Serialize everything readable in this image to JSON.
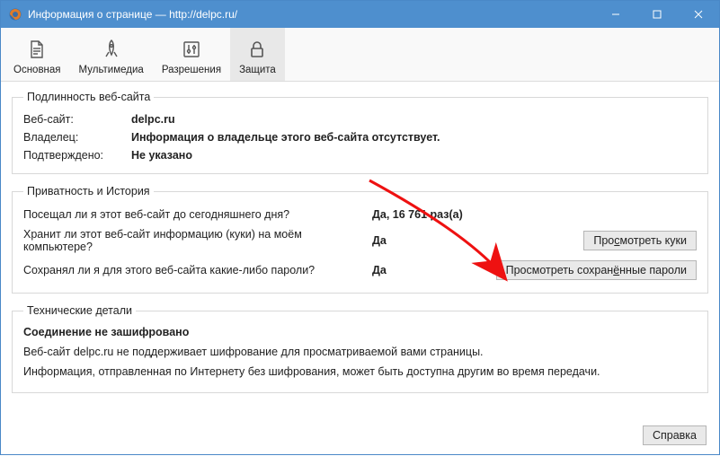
{
  "titlebar": {
    "text": "Информация о странице — http://delpc.ru/"
  },
  "tabs": {
    "general": {
      "label": "Основная"
    },
    "media": {
      "label": "Мультимедиа"
    },
    "permissions": {
      "label": "Разрешения"
    },
    "security": {
      "label": "Защита"
    }
  },
  "identity": {
    "legend": "Подлинность веб-сайта",
    "website_label": "Веб-сайт:",
    "website_value": "delpc.ru",
    "owner_label": "Владелец:",
    "owner_value": "Информация о владельце этого веб-сайта отсутствует.",
    "verified_label": "Подтверждено:",
    "verified_value": "Не указано"
  },
  "privacy": {
    "legend": "Приватность и История",
    "visited_q": "Посещал ли я этот веб-сайт до сегодняшнего дня?",
    "visited_a": "Да, 16 761 раз(а)",
    "cookies_q": "Хранит ли этот веб-сайт информацию (куки) на моём компьютере?",
    "cookies_a": "Да",
    "cookies_btn_pre": "Про",
    "cookies_btn_u": "с",
    "cookies_btn_post": "мотреть куки",
    "passwords_q": "Сохранял ли я для этого веб-сайта какие-либо пароли?",
    "passwords_a": "Да",
    "passwords_btn_pre": "Просмотреть сохран",
    "passwords_btn_u": "ё",
    "passwords_btn_post": "нные пароли"
  },
  "technical": {
    "legend": "Технические детали",
    "heading": "Соединение не зашифровано",
    "line1": "Веб-сайт delpc.ru не поддерживает шифрование для просматриваемой вами страницы.",
    "line2": "Информация, отправленная по Интернету без шифрования, может быть доступна другим во время передачи."
  },
  "footer": {
    "help_btn": "Справка"
  }
}
